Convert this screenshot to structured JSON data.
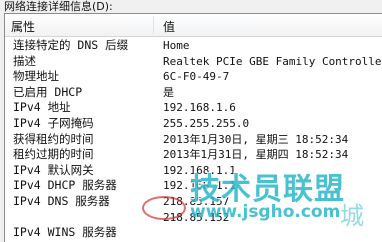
{
  "caption": "网络连接详细信息(D):",
  "columns": {
    "property": "属性",
    "value": "值"
  },
  "rows": [
    {
      "property": "连接特定的 DNS 后缀",
      "value": "Home"
    },
    {
      "property": "描述",
      "value": "Realtek PCIe GBE Family Controlle"
    },
    {
      "property": "物理地址",
      "value": "6C-F0-49-7"
    },
    {
      "property": "已启用 DHCP",
      "value": "是"
    },
    {
      "property": "IPv4 地址",
      "value": "192.168.1.6"
    },
    {
      "property": "IPv4 子网掩码",
      "value": "255.255.255.0"
    },
    {
      "property": "获得租约的时间",
      "value": "2013年1月30日, 星期三 18:52:34"
    },
    {
      "property": "租约过期的时间",
      "value": "2013年1月31日, 星期四 18:52:34"
    },
    {
      "property": "IPv4 默认网关",
      "value": "192.168.1.1"
    },
    {
      "property": "IPv4 DHCP 服务器",
      "value": "192.168.1.1"
    },
    {
      "property": "IPv4 DNS 服务器",
      "value": "218.85.157"
    },
    {
      "property": "",
      "value": "218.85.152"
    },
    {
      "property": "IPv4 WINS 服务器",
      "value": ""
    }
  ],
  "watermark": {
    "logo": "技术员联盟",
    "url": "www.jsgho.com",
    "city": "城"
  }
}
